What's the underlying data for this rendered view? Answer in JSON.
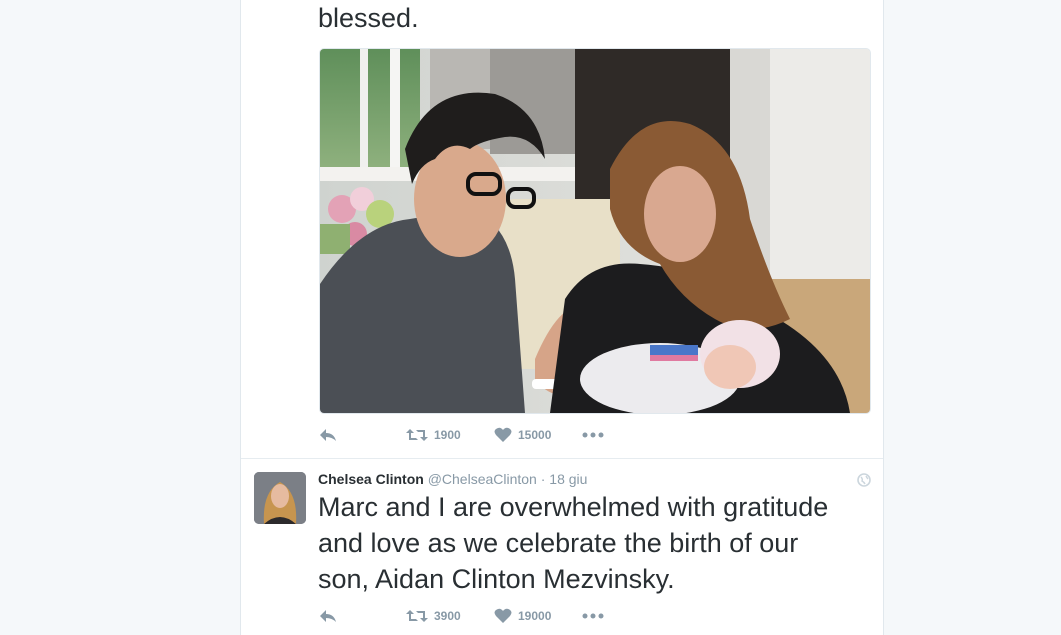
{
  "tweet1": {
    "text": "blessed.",
    "retweets": "1900",
    "likes": "15000"
  },
  "tweet2": {
    "fullname": "Chelsea Clinton",
    "username": "@ChelseaClinton",
    "separator": "·",
    "date": "18 giu",
    "text_lines": [
      "Marc and I are overwhelmed with gratitude",
      "and love as we celebrate the birth of our",
      "son, Aidan Clinton Mezvinsky."
    ],
    "retweets": "3900",
    "likes": "19000"
  },
  "icons": {
    "reply": "reply-icon",
    "retweet": "retweet-icon",
    "like": "heart-icon",
    "more": "more-icon",
    "globe": "globe-icon"
  },
  "colors": {
    "page_bg": "#f5f8fa",
    "card_bg": "#ffffff",
    "text": "#292f33",
    "muted": "#8899a6",
    "border": "#e1e8ed"
  }
}
